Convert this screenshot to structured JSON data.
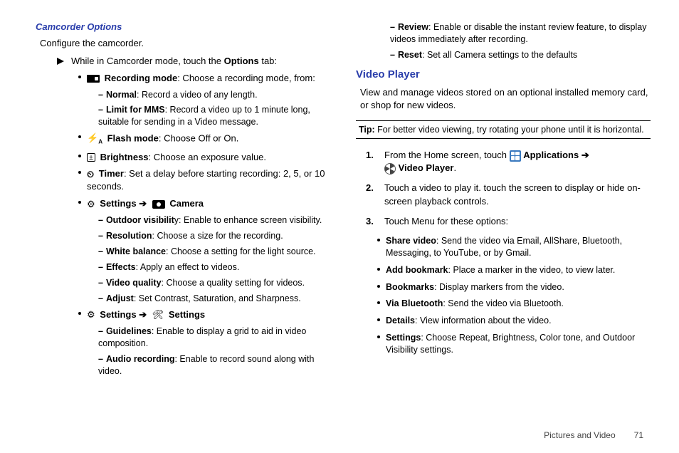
{
  "left": {
    "title": "Camcorder Options",
    "intro": "Configure the camcorder.",
    "play_prefix": "While in Camcorder mode, touch the ",
    "play_bold": "Options",
    "play_suffix": " tab:",
    "rec_label": "Recording mode",
    "rec_desc": ": Choose a recording mode, from:",
    "normal_b": "Normal",
    "normal_t": ": Record a video of any length.",
    "limit_b": "Limit for MMS",
    "limit_t": ": Record a video up to 1 minute long, suitable for sending in a Video message.",
    "flash_b": "Flash mode",
    "flash_t": ": Choose Off or On.",
    "bright_b": "Brightness",
    "bright_t": ": Choose an exposure value.",
    "timer_b": "Timer",
    "timer_t": ": Set a delay before starting recording: 2, 5, or 10 seconds.",
    "settings_b": "Settings ",
    "arrow": "➔",
    "camera_b": " Camera",
    "outdoor_b": "Outdoor visibilit",
    "outdoor_t": "y: Enable to enhance screen visibility.",
    "res_b": "Resolution",
    "res_t": ": Choose a size for the recording.",
    "wb_b": "White balance",
    "wb_t": ": Choose a setting for the light source.",
    "eff_b": "Effects",
    "eff_t": ": Apply an effect to videos.",
    "vq_b": "Video quality",
    "vq_t": ": Choose a quality setting for videos.",
    "adj_b": "Adjust",
    "adj_t": ": Set Contrast, Saturation, and Sharpness.",
    "settings2_b": " Settings",
    "guide_b": "Guidelines",
    "guide_t": ": Enable to display a grid to aid in video composition.",
    "audio_b": "Audio recording",
    "audio_t": ": Enable to record sound along with video."
  },
  "right": {
    "review_b": "Review",
    "review_t": ": Enable or disable the instant review feature, to display videos immediately after recording.",
    "reset_b": "Reset",
    "reset_t": ": Set all Camera settings to the defaults",
    "h": "Video Player",
    "intro": "View and manage videos stored on an optional installed memory card, or shop for new videos.",
    "tip_b": "Tip:",
    "tip_t": " For better video viewing, try rotating your phone until it is horizontal.",
    "s1_pre": "From the Home screen, touch ",
    "s1_apps": " Applications ",
    "s1_arrow": "➔",
    "s1_vp": " Video Player",
    "s1_dot": ".",
    "s2": "Touch a video to play it. touch the screen to display or hide on-screen playback controls.",
    "s3": "Touch Menu for these options:",
    "share_b": "Share video",
    "share_t": ": Send the video via Email, AllShare, Bluetooth, Messaging, to YouTube, or by Gmail.",
    "book_b": "Add bookmark",
    "book_t": ": Place a marker in the video, to view later.",
    "books_b": "Bookmarks",
    "books_t": ": Display markers from the video.",
    "bt_b": "Via Bluetooth",
    "bt_t": ": Send the video via Bluetooth.",
    "det_b": "Details",
    "det_t": ": View information about the video.",
    "set_b": "Settings",
    "set_t": ": Choose Repeat, Brightness, Color tone, and Outdoor Visibility settings."
  },
  "footer": {
    "section": "Pictures and Video",
    "page": "71"
  }
}
